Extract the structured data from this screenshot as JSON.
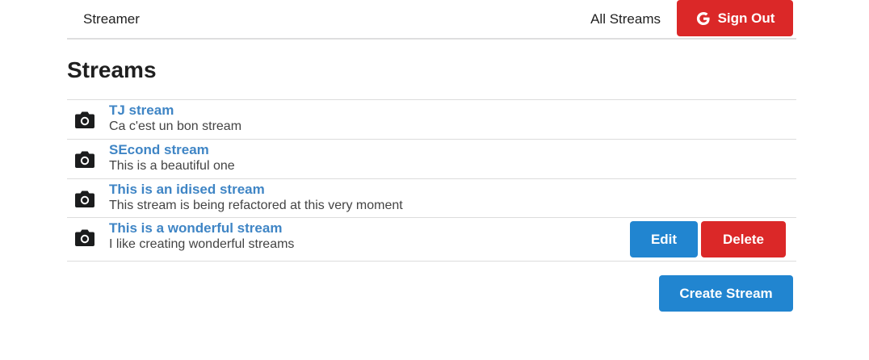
{
  "header": {
    "brand": "Streamer",
    "all_streams": "All Streams",
    "signout_label": "Sign Out"
  },
  "page": {
    "title": "Streams"
  },
  "streams": [
    {
      "title": "TJ stream",
      "description": "Ca c'est un bon stream",
      "icon": "camera-icon"
    },
    {
      "title": "SEcond stream",
      "description": "This is a beautiful one",
      "icon": "camera-icon"
    },
    {
      "title": "This is an idised stream",
      "description": "This stream is being refactored at this very moment",
      "icon": "camera-icon"
    },
    {
      "title": "This is a wonderful stream",
      "description": "I like creating wonderful streams",
      "icon": "camera-icon",
      "edit_label": "Edit",
      "delete_label": "Delete"
    }
  ],
  "create_label": "Create Stream",
  "colors": {
    "primary": "#2185d0",
    "danger": "#db2828",
    "link": "#3f85c5"
  }
}
